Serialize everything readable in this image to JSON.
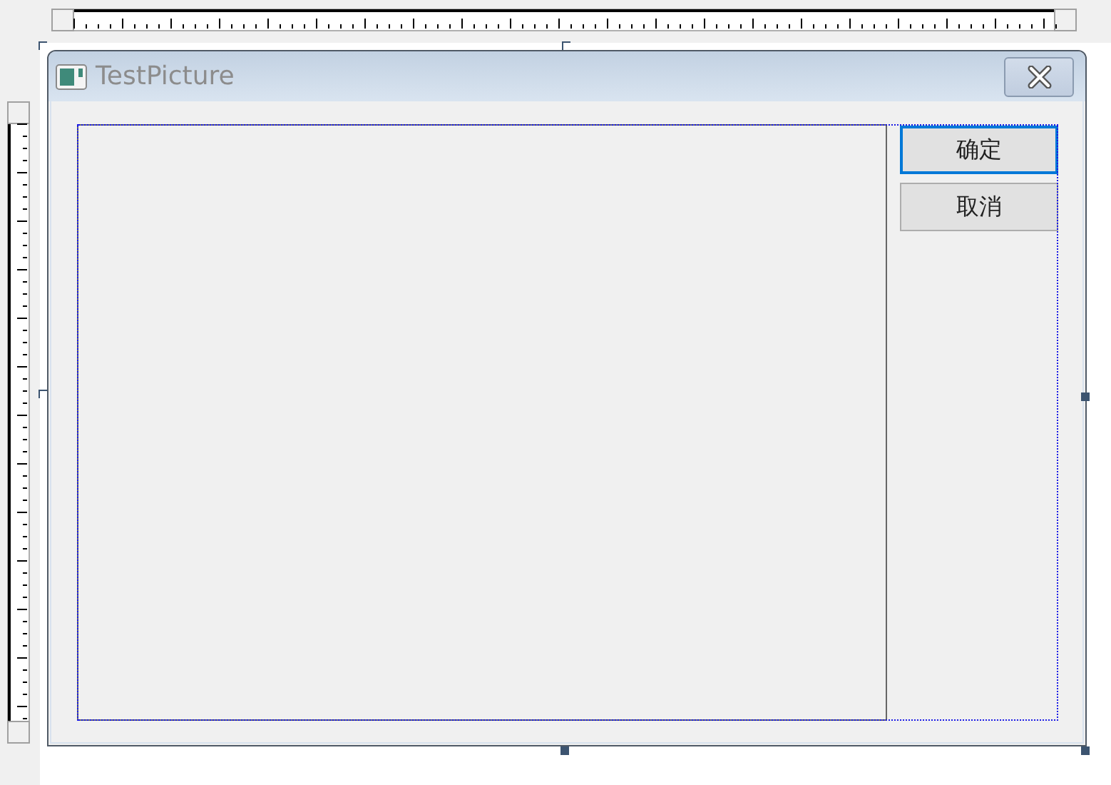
{
  "window": {
    "title": "TestPicture"
  },
  "buttons": [
    {
      "label": "确定",
      "selected": true
    },
    {
      "label": "取消",
      "selected": false
    }
  ]
}
